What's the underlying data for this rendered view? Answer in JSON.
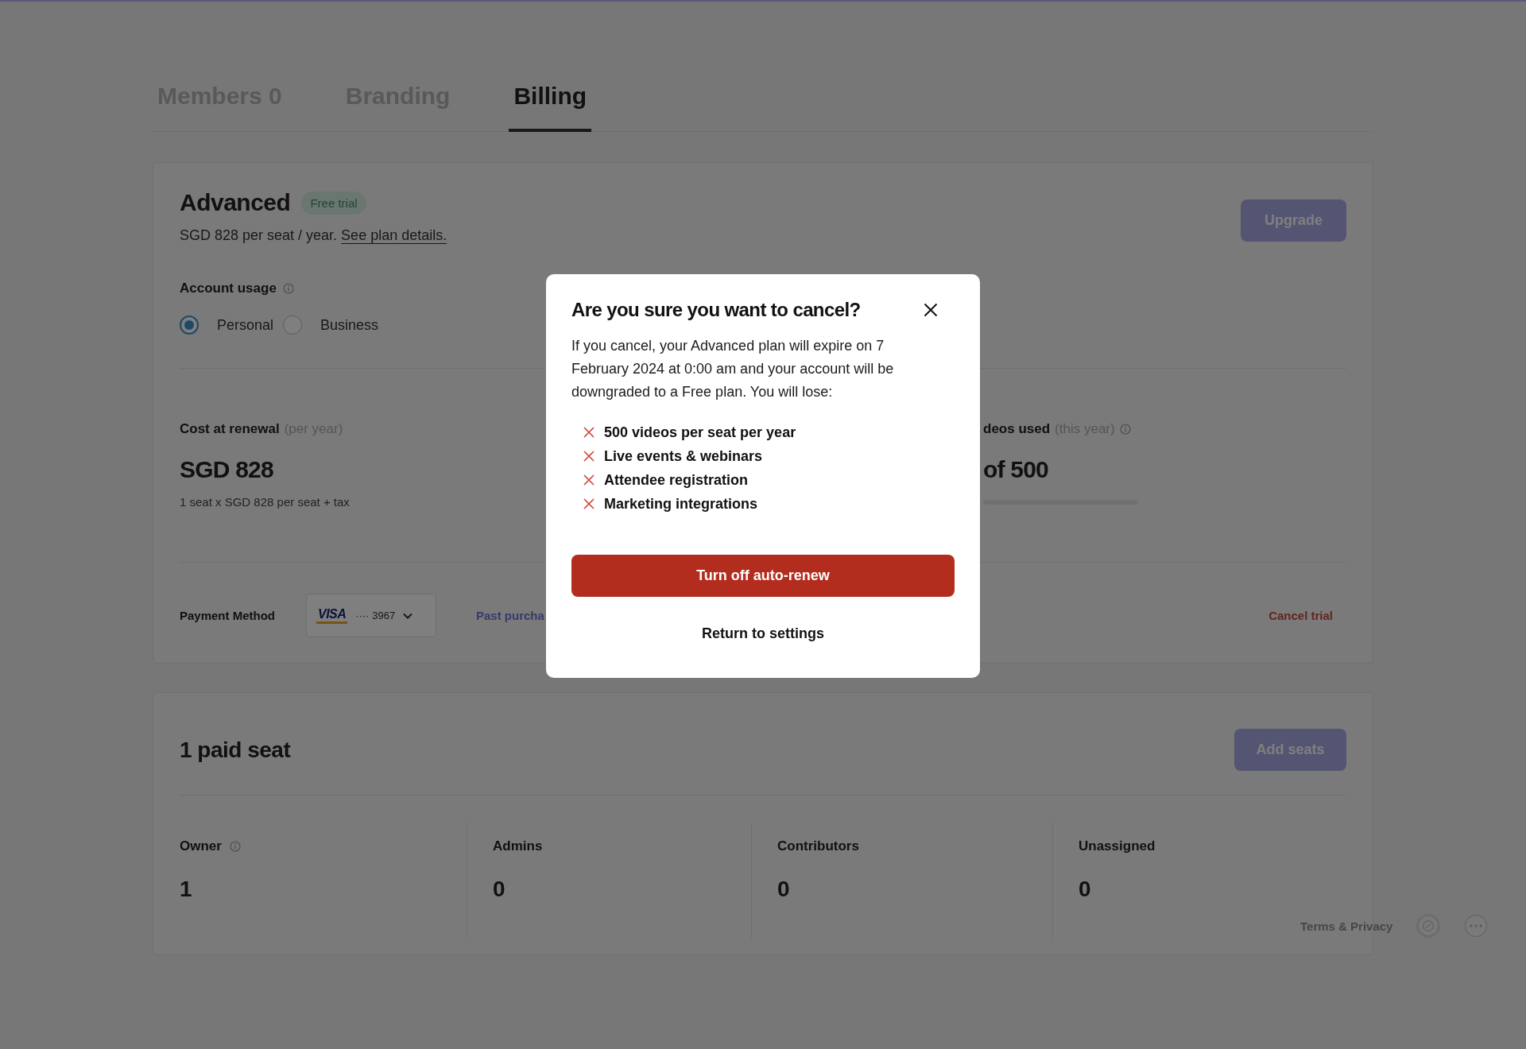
{
  "tabs": [
    {
      "label": "Members 0",
      "selected": false
    },
    {
      "label": "Branding",
      "selected": false
    },
    {
      "label": "Billing",
      "selected": true
    }
  ],
  "plan": {
    "name": "Advanced",
    "badge": "Free trial",
    "price_text": "SGD 828 per seat / year.",
    "details_link": "See plan details.",
    "upgrade_button": "Upgrade",
    "account_usage": {
      "label": "Account usage",
      "options": [
        {
          "label": "Personal",
          "selected": true
        },
        {
          "label": "Business",
          "selected": false
        }
      ]
    },
    "cost": {
      "label": "Cost at renewal",
      "qualifier": "(per year)",
      "amount": "SGD 828",
      "detail": "1 seat x SGD 828 per seat + tax"
    },
    "videos": {
      "label": "deos used",
      "qualifier": "(this year)",
      "amount": "of 500"
    },
    "payment": {
      "label": "Payment Method",
      "card_brand": "VISA",
      "card_dots": "····",
      "card_last4": "3967",
      "past_purchases_link": "Past purcha",
      "cancel_link": "Cancel trial"
    }
  },
  "seats": {
    "title": "1 paid seat",
    "add_button": "Add seats",
    "stats": [
      {
        "label": "Owner",
        "value": "1",
        "info": true
      },
      {
        "label": "Admins",
        "value": "0",
        "info": false
      },
      {
        "label": "Contributors",
        "value": "0",
        "info": false
      },
      {
        "label": "Unassigned",
        "value": "0",
        "info": false
      }
    ]
  },
  "footer": {
    "terms_link": "Terms & Privacy"
  },
  "modal": {
    "title": "Are you sure you want to cancel?",
    "body": "If you cancel, your Advanced plan will expire on 7 February 2024 at 0:00 am and your account will be downgraded to a Free plan. You will lose:",
    "losses": [
      "500 videos per seat per year",
      "Live events & webinars",
      "Attendee registration",
      "Marketing integrations"
    ],
    "confirm_button": "Turn off auto-renew",
    "return_button": "Return to settings"
  }
}
